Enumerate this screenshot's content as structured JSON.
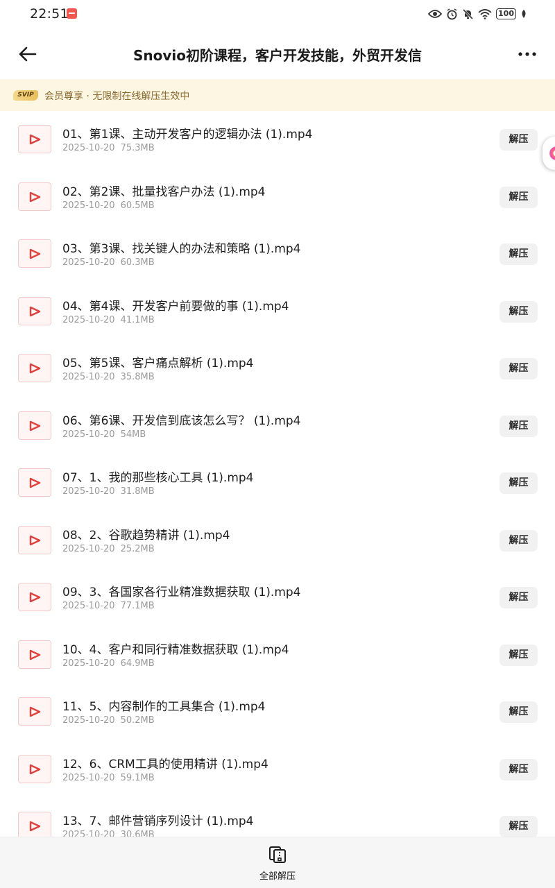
{
  "status_bar": {
    "time": "22:51",
    "battery": "100",
    "icons": [
      "eye-icon",
      "alarm-icon",
      "mute-icon",
      "wifi-icon",
      "battery-icon",
      "leaf-icon"
    ]
  },
  "header": {
    "title": "Snovio初阶课程，客户开发技能，外贸开发信"
  },
  "vip_banner": {
    "badge": "SVIP",
    "text": "会员尊享 · 无限制在线解压生效中"
  },
  "files": [
    {
      "name": "01、第1课、主动开发客户的逻辑办法 (1).mp4",
      "date": "2025-10-20",
      "size": "75.3MB",
      "action": "解压"
    },
    {
      "name": "02、第2课、批量找客户办法 (1).mp4",
      "date": "2025-10-20",
      "size": "60.5MB",
      "action": "解压"
    },
    {
      "name": "03、第3课、找关键人的办法和策略 (1).mp4",
      "date": "2025-10-20",
      "size": "60.3MB",
      "action": "解压"
    },
    {
      "name": "04、第4课、开发客户前要做的事 (1).mp4",
      "date": "2025-10-20",
      "size": "41.1MB",
      "action": "解压"
    },
    {
      "name": "05、第5课、客户痛点解析 (1).mp4",
      "date": "2025-10-20",
      "size": "35.8MB",
      "action": "解压"
    },
    {
      "name": "06、第6课、开发信到底该怎么写？ (1).mp4",
      "date": "2025-10-20",
      "size": "54MB",
      "action": "解压"
    },
    {
      "name": "07、1、我的那些核心工具 (1).mp4",
      "date": "2025-10-20",
      "size": "31.8MB",
      "action": "解压"
    },
    {
      "name": "08、2、谷歌趋势精讲 (1).mp4",
      "date": "2025-10-20",
      "size": "25.2MB",
      "action": "解压"
    },
    {
      "name": "09、3、各国家各行业精准数据获取 (1).mp4",
      "date": "2025-10-20",
      "size": "77.1MB",
      "action": "解压"
    },
    {
      "name": "10、4、客户和同行精准数据获取 (1).mp4",
      "date": "2025-10-20",
      "size": "64.9MB",
      "action": "解压"
    },
    {
      "name": "11、5、内容制作的工具集合 (1).mp4",
      "date": "2025-10-20",
      "size": "50.2MB",
      "action": "解压"
    },
    {
      "name": "12、6、CRM工具的使用精讲 (1).mp4",
      "date": "2025-10-20",
      "size": "59.1MB",
      "action": "解压"
    },
    {
      "name": "13、7、邮件营销序列设计 (1).mp4",
      "date": "2025-10-20",
      "size": "30.6MB",
      "action": "解压"
    }
  ],
  "bottom_bar": {
    "extract_all_label": "全部解压"
  },
  "colors": {
    "accent_red": "#e0413c",
    "vip_bg": "#fdf6e3",
    "vip_text": "#8a6a2e"
  }
}
